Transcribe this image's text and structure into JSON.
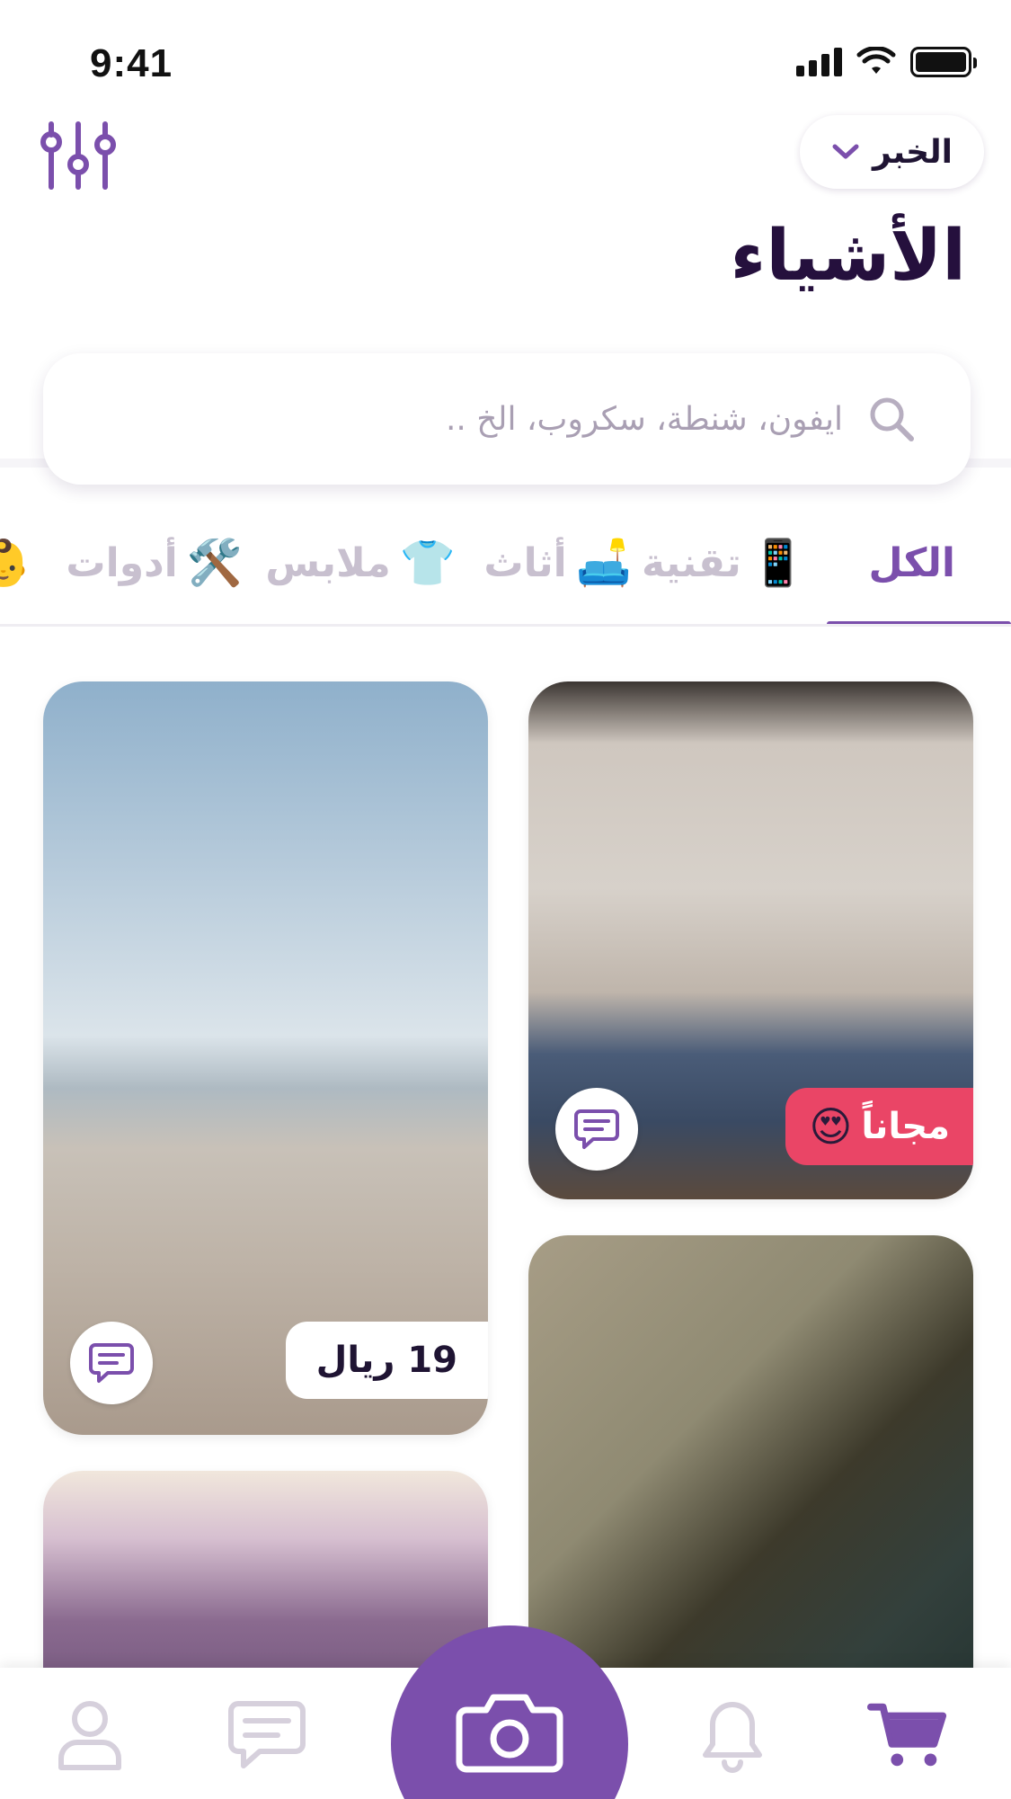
{
  "status_bar": {
    "time": "9:41"
  },
  "header": {
    "dropdown_label": "الخبر",
    "title": "الأشياء"
  },
  "search": {
    "placeholder": "ايفون، شنطة، سكروب، الخ .."
  },
  "tabs": [
    {
      "label": "الكل",
      "icon": "",
      "active": true
    },
    {
      "label": "تقنية",
      "icon": "📱",
      "active": false
    },
    {
      "label": "أثاث",
      "icon": "🛋️",
      "active": false
    },
    {
      "label": "ملابس",
      "icon": "👕",
      "active": false
    },
    {
      "label": "أدوات",
      "icon": "🛠️",
      "active": false
    },
    {
      "label": "",
      "icon": "👶",
      "active": false
    }
  ],
  "cards": [
    {
      "id": "beach",
      "image": "beach photo",
      "price": "19 ريال"
    },
    {
      "id": "bedroom",
      "image": "bedroom photo",
      "free_label": "مجاناً",
      "free_emoji": "😍"
    },
    {
      "id": "candle",
      "image": "candle photo",
      "price": ""
    },
    {
      "id": "purple-room",
      "image": "purple room photo"
    }
  ],
  "colors": {
    "accent": "#7b4fac",
    "free_badge": "#ea4566",
    "title": "#25103d",
    "inactive_tab": "#c8c0cf"
  },
  "bottom_nav": [
    {
      "name": "profile-icon",
      "active": false
    },
    {
      "name": "chat-icon",
      "active": false
    },
    {
      "name": "camera-icon",
      "active": false
    },
    {
      "name": "bell-icon",
      "active": false
    },
    {
      "name": "cart-icon",
      "active": true
    }
  ]
}
